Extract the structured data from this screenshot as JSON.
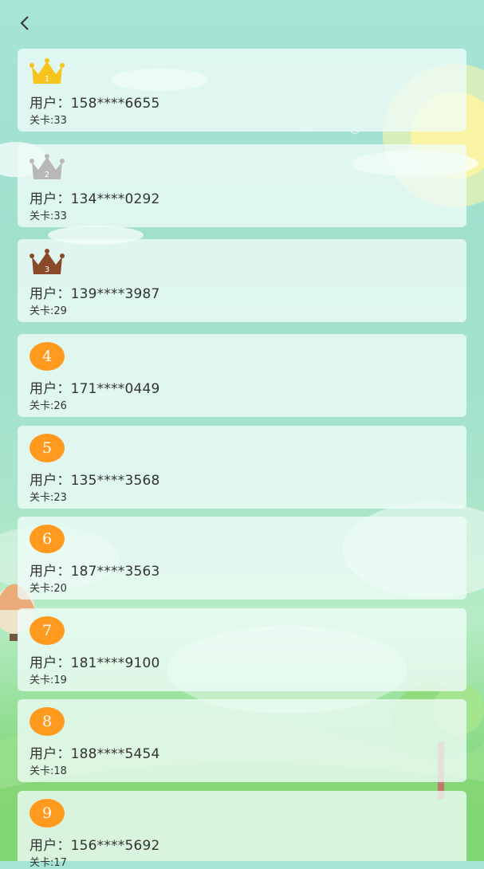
{
  "header": {
    "back_icon": "chevron-left-icon"
  },
  "labels": {
    "user_prefix": "用户：",
    "level_prefix": "关卡:"
  },
  "colors": {
    "gold": "#f7c41d",
    "silver": "#b8b8b8",
    "bronze": "#8a4a2a",
    "rank_circle": "#ff9a1f"
  },
  "ranking": [
    {
      "rank": "1",
      "badge": "gold-crown-icon",
      "phone": "158****6655",
      "level": "33"
    },
    {
      "rank": "2",
      "badge": "silver-crown-icon",
      "phone": "134****0292",
      "level": "33"
    },
    {
      "rank": "3",
      "badge": "bronze-crown-icon",
      "phone": "139****3987",
      "level": "29"
    },
    {
      "rank": "4",
      "badge": "rank-circle",
      "phone": "171****0449",
      "level": "26"
    },
    {
      "rank": "5",
      "badge": "rank-circle",
      "phone": "135****3568",
      "level": "23"
    },
    {
      "rank": "6",
      "badge": "rank-circle",
      "phone": "187****3563",
      "level": "20"
    },
    {
      "rank": "7",
      "badge": "rank-circle",
      "phone": "181****9100",
      "level": "19"
    },
    {
      "rank": "8",
      "badge": "rank-circle",
      "phone": "188****5454",
      "level": "18"
    },
    {
      "rank": "9",
      "badge": "rank-circle",
      "phone": "156****5692",
      "level": "17"
    }
  ]
}
